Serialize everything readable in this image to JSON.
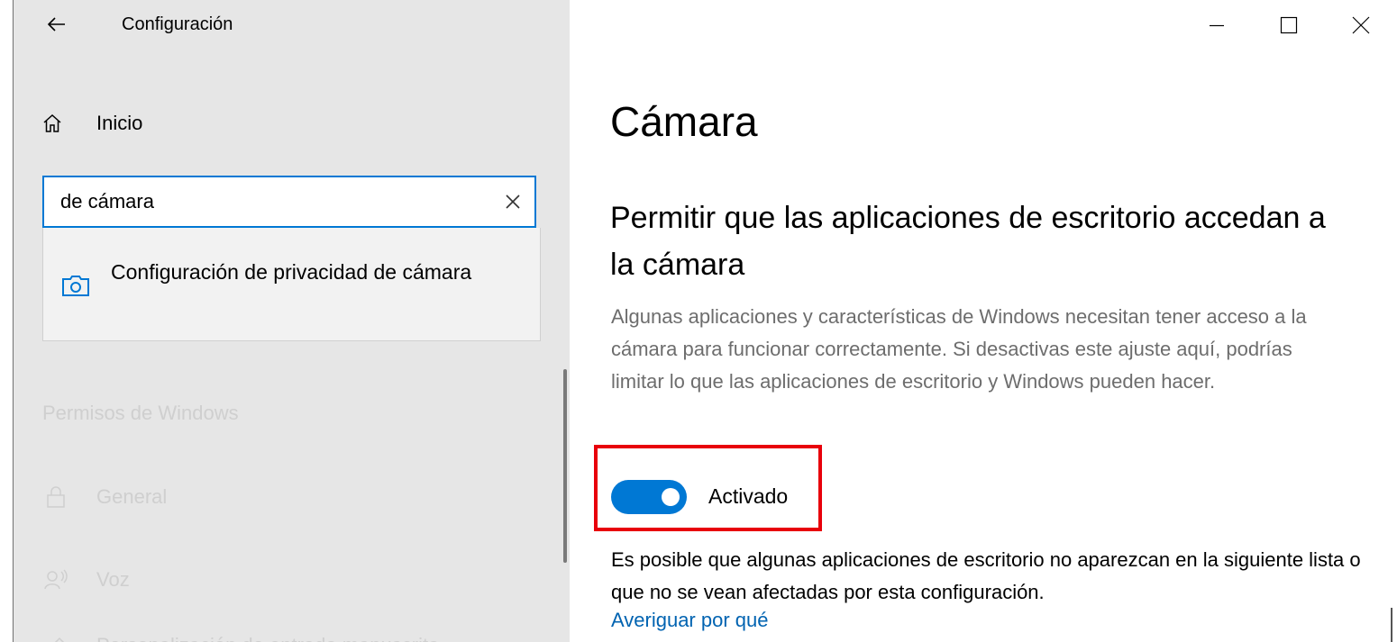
{
  "app": {
    "title": "Configuración"
  },
  "sidebar": {
    "home_label": "Inicio",
    "search": {
      "value": "de cámara",
      "placeholder": ""
    },
    "suggestion": {
      "label": "Configuración de privacidad de cámara",
      "icon": "camera-icon"
    },
    "section_header": "Permisos de Windows",
    "items": [
      {
        "label": "General",
        "icon": "lock-icon"
      },
      {
        "label": "Voz",
        "icon": "speech-icon"
      },
      {
        "label": "Personalización de entrada manuscrita",
        "icon": "pen-icon"
      }
    ]
  },
  "main": {
    "page_title": "Cámara",
    "section_title": "Permitir que las aplicaciones de escritorio accedan a la cámara",
    "description": "Algunas aplicaciones y características de Windows necesitan tener acceso a la cámara para funcionar correctamente. Si desactivas este ajuste aquí, podrías limitar lo que las aplicaciones de escritorio y Windows pueden hacer.",
    "toggle": {
      "state_label": "Activado",
      "on": true
    },
    "note": "Es posible que algunas aplicaciones de escritorio no aparezcan en la siguiente lista o que no se vean afectadas por esta configuración.",
    "link": "Averiguar por qué"
  },
  "colors": {
    "accent": "#0078d4",
    "link": "#0063b1",
    "highlight": "#e8000b",
    "sidebar_bg": "#e6e6e6"
  }
}
